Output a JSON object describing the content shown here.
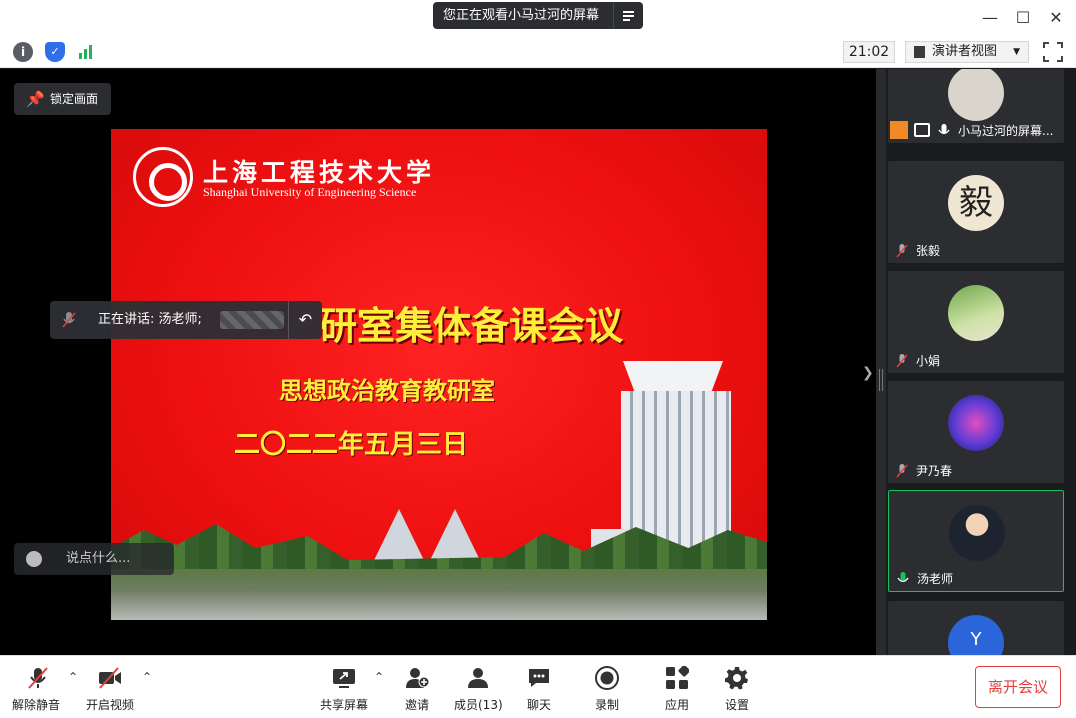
{
  "share_banner": {
    "text": "您正在观看小马过河的屏幕"
  },
  "infobar": {
    "clock": "21:02",
    "view_mode": "演讲者视图"
  },
  "stage": {
    "lock_label": "锁定画面",
    "speaking_label": "正在讲话: 汤老师;",
    "chat_placeholder": "说点什么...",
    "slide": {
      "logo_cn": "上海工程技术大学",
      "logo_en": "Shanghai University of Engineering Science",
      "title": "研室集体备课会议",
      "subtitle": "思想政治教育教研室",
      "date": "二〇二二年五月三日"
    }
  },
  "participants": [
    {
      "name": "小马过河的屏幕...",
      "muted": false,
      "active": false,
      "host": true
    },
    {
      "name": "张毅",
      "muted": true,
      "active": false
    },
    {
      "name": "小娟",
      "muted": true,
      "active": false
    },
    {
      "name": "尹乃春",
      "muted": true,
      "active": false
    },
    {
      "name": "汤老师",
      "muted": false,
      "active": true
    },
    {
      "name": "",
      "muted": false,
      "active": false
    }
  ],
  "toolbar": {
    "unmute": "解除静音",
    "video": "开启视频",
    "share": "共享屏幕",
    "invite": "邀请",
    "members": "成员(13)",
    "chat": "聊天",
    "record": "录制",
    "apps": "应用",
    "settings": "设置",
    "leave": "离开会议"
  },
  "colors": {
    "accent_green": "#19c15c",
    "leave_red": "#e43e3e",
    "slide_red": "#ee1010",
    "slide_text": "#ffef3b"
  }
}
